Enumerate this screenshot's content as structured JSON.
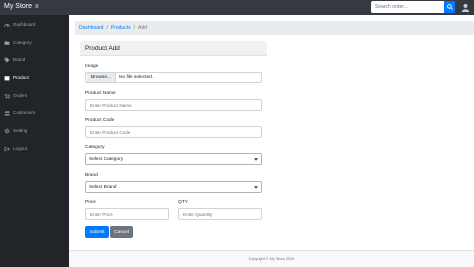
{
  "topbar": {
    "brand": "My Store",
    "menu_icon": "≡",
    "search_placeholder": "Search order...",
    "search_icon": "search-icon",
    "user_icon": "user-icon"
  },
  "sidebar": {
    "items": [
      {
        "label": "Dashboard",
        "icon": "gauge-icon"
      },
      {
        "label": "Category",
        "icon": "folder-icon"
      },
      {
        "label": "Brand",
        "icon": "tag-icon"
      },
      {
        "label": "Product",
        "icon": "box-icon"
      },
      {
        "label": "Orders",
        "icon": "cart-icon"
      },
      {
        "label": "Customers",
        "icon": "users-icon"
      },
      {
        "label": "Setting",
        "icon": "gear-icon"
      },
      {
        "label": "Logout",
        "icon": "logout-icon"
      }
    ],
    "active": "Product"
  },
  "breadcrumb": {
    "items": [
      "Dashboard",
      "Products",
      "Add"
    ],
    "separator": "/"
  },
  "card": {
    "title": "Product Add"
  },
  "form": {
    "image_label": "Image",
    "browse_label": "Browse...",
    "file_status": "No file selected.",
    "name_label": "Product Name",
    "name_placeholder": "Enter Product Name",
    "code_label": "Product Code",
    "code_placeholder": "Enter Product Code",
    "category_label": "Category",
    "category_value": "Select Category",
    "brand_label": "Brand",
    "brand_value": "Select Brand",
    "price_label": "Price",
    "price_placeholder": "Enter Price",
    "qty_label": "QTY",
    "qty_placeholder": "Enter Quantity",
    "submit_label": "Submit",
    "cancel_label": "Cancel"
  },
  "footer": {
    "text": "Copyright © My Store 2020"
  },
  "colors": {
    "primary": "#007bff",
    "secondary": "#6c757d",
    "topbar": "#343a40",
    "sidebar": "#212529"
  }
}
